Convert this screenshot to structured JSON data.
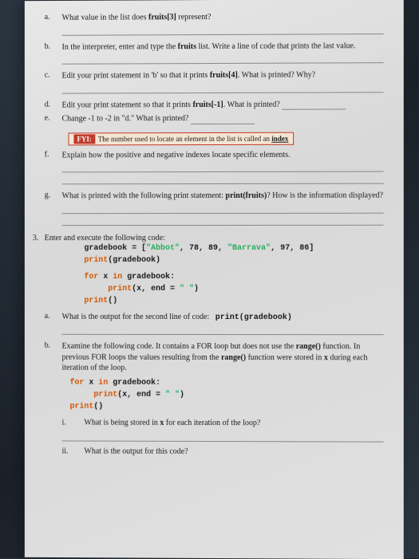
{
  "items": {
    "a": {
      "label": "a.",
      "text": "What value in the list does ",
      "bold1": "fruits[3]",
      "text2": " represent?"
    },
    "b": {
      "label": "b.",
      "text": "In the interpreter, enter and type the ",
      "bold1": "fruits",
      "text2": " list. Write a line of code that prints the last value."
    },
    "c": {
      "label": "c.",
      "text": "Edit your print statement in 'b' so that it prints ",
      "bold1": "fruits[4]",
      "text2": ". What is printed? Why?"
    },
    "d": {
      "label": "d.",
      "text": "Edit your print statement so that it prints ",
      "bold1": "fruits[-1]",
      "text2": ". What is printed?"
    },
    "e": {
      "label": "e.",
      "text": "Change -1 to -2 in \"d.\" What is printed?"
    },
    "f": {
      "label": "f.",
      "text": "Explain how the positive and negative indexes locate specific elements."
    },
    "g": {
      "label": "g.",
      "text": "What is printed with the following print statement: ",
      "bold1": "print(fruits)",
      "text2": "? How is the information displayed?"
    }
  },
  "fyi": {
    "label": "FYI:",
    "text": "The number used to locate an element in the list is called an ",
    "bold": "index"
  },
  "q3": {
    "num": "3.",
    "intro": "Enter and execute the following code:",
    "code": {
      "l1a": "gradebook = [",
      "l1s1": "\"Abbot\"",
      "l1b": ", 78, 89, ",
      "l1s2": "\"Barrava\"",
      "l1c": ", 97, 86]",
      "l2": "print",
      "l2b": "(gradebook)",
      "l3a": "for",
      "l3b": " x ",
      "l3c": "in",
      "l3d": " gradebook:",
      "l4a": "print",
      "l4b": "(x, end = ",
      "l4s": "\" \"",
      "l4c": ")",
      "l5": "print",
      "l5b": "()"
    },
    "a": {
      "label": "a.",
      "text": "What is the output for the second line of code:",
      "code": "print(gradebook)"
    },
    "b": {
      "label": "b.",
      "text": "Examine the following code. It contains a FOR loop but does not use the ",
      "bold1": "range()",
      "text2": " function. In previous FOR loops the values resulting from the ",
      "bold2": "range()",
      "text3": " function were stored in ",
      "bold3": "x",
      "text4": " during each iteration of the loop.",
      "code": {
        "l1a": "for",
        "l1b": " x ",
        "l1c": "in",
        "l1d": " gradebook:",
        "l2a": "print",
        "l2b": "(x, end = ",
        "l2s": "\" \"",
        "l2c": ")",
        "l3": "print",
        "l3b": "()"
      },
      "i": {
        "label": "i.",
        "text": "What is being stored in ",
        "bold": "x",
        "text2": " for each iteration of the loop?"
      },
      "ii": {
        "label": "ii.",
        "text": "What is the output for this code?"
      }
    }
  }
}
